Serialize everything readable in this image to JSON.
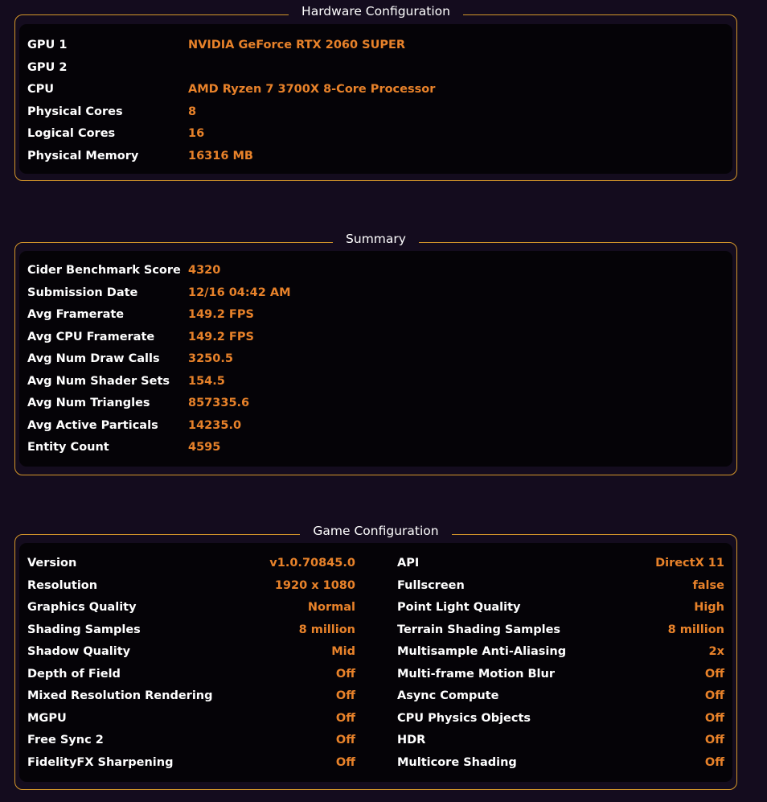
{
  "hardware": {
    "title": "Hardware Configuration",
    "rows": [
      {
        "label": "GPU 1",
        "value": "NVIDIA GeForce RTX 2060 SUPER"
      },
      {
        "label": "GPU 2",
        "value": ""
      },
      {
        "label": "CPU",
        "value": "AMD Ryzen 7 3700X 8-Core Processor"
      },
      {
        "label": "Physical Cores",
        "value": "8"
      },
      {
        "label": "Logical Cores",
        "value": "16"
      },
      {
        "label": "Physical Memory",
        "value": "16316 MB"
      }
    ]
  },
  "summary": {
    "title": "Summary",
    "rows": [
      {
        "label": "Cider Benchmark Score",
        "value": "4320"
      },
      {
        "label": "Submission Date",
        "value": "12/16 04:42 AM"
      },
      {
        "label": "Avg Framerate",
        "value": "149.2 FPS"
      },
      {
        "label": "Avg CPU Framerate",
        "value": "149.2 FPS"
      },
      {
        "label": "Avg Num Draw Calls",
        "value": "3250.5"
      },
      {
        "label": "Avg Num Shader Sets",
        "value": "154.5"
      },
      {
        "label": "Avg Num Triangles",
        "value": "857335.6"
      },
      {
        "label": "Avg Active Particals",
        "value": "14235.0"
      },
      {
        "label": "Entity Count",
        "value": "4595"
      }
    ]
  },
  "game": {
    "title": "Game Configuration",
    "left": [
      {
        "label": "Version",
        "value": "v1.0.70845.0"
      },
      {
        "label": "Resolution",
        "value": "1920 x 1080"
      },
      {
        "label": "Graphics Quality",
        "value": "Normal"
      },
      {
        "label": "Shading Samples",
        "value": "8 million"
      },
      {
        "label": "Shadow Quality",
        "value": "Mid"
      },
      {
        "label": "Depth of Field",
        "value": "Off"
      },
      {
        "label": "Mixed Resolution Rendering",
        "value": "Off"
      },
      {
        "label": "MGPU",
        "value": "Off"
      },
      {
        "label": "Free Sync 2",
        "value": "Off"
      },
      {
        "label": "FidelityFX Sharpening",
        "value": "Off"
      }
    ],
    "right": [
      {
        "label": "API",
        "value": "DirectX 11"
      },
      {
        "label": "Fullscreen",
        "value": "false"
      },
      {
        "label": "Point Light Quality",
        "value": "High"
      },
      {
        "label": "Terrain Shading Samples",
        "value": "8 million"
      },
      {
        "label": "Multisample Anti-Aliasing",
        "value": "2x"
      },
      {
        "label": "Multi-frame Motion Blur",
        "value": "Off"
      },
      {
        "label": "Async Compute",
        "value": "Off"
      },
      {
        "label": "CPU Physics Objects",
        "value": "Off"
      },
      {
        "label": "HDR",
        "value": "Off"
      },
      {
        "label": "Multicore Shading",
        "value": "Off"
      }
    ]
  },
  "colors": {
    "accent": "#d4962a",
    "value": "#e8822a",
    "background": "#140c1e",
    "panel": "#050307"
  }
}
